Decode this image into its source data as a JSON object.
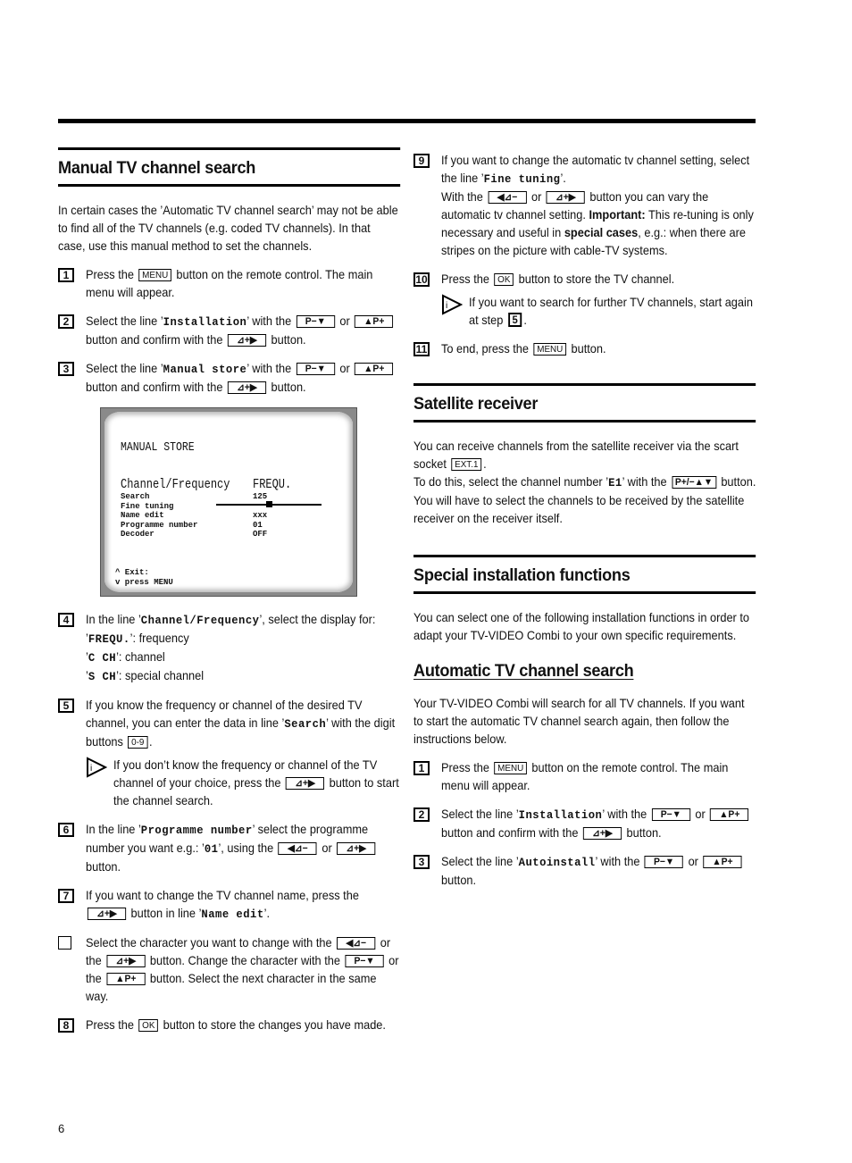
{
  "page_number": "6",
  "left": {
    "heading": "Manual TV channel search",
    "intro": "In certain cases the ’Automatic TV channel search’ may not be able to find all of the TV channels (e.g. coded TV channels). In that case, use this manual method to set the channels.",
    "steps": [
      {
        "num": "1",
        "parts": [
          "Press the ",
          {
            "key": "MENU"
          },
          " button on the remote control. The main menu will appear."
        ]
      },
      {
        "num": "2",
        "parts": [
          "Select the line ’",
          {
            "mono": "Installation"
          },
          "’ with the ",
          {
            "key": "P−▼"
          },
          " or ",
          {
            "key": "▲P+"
          },
          " button and confirm with the ",
          {
            "key": "⊿+▶"
          },
          " button."
        ]
      },
      {
        "num": "3",
        "parts": [
          "Select the line ’",
          {
            "mono": "Manual store"
          },
          "’ with the ",
          {
            "key": "P−▼"
          },
          " or ",
          {
            "key": "▲P+"
          },
          " button and confirm with the ",
          {
            "key": "⊿+▶"
          },
          " button."
        ]
      }
    ],
    "tv_screen": {
      "title": "MANUAL STORE",
      "channel_frequency_label": "Channel/Frequency",
      "channel_frequency_value": "FREQU.",
      "rows": [
        {
          "label": "Search",
          "value": "125"
        },
        {
          "label": "Fine tuning",
          "value": ""
        },
        {
          "label": "Name edit",
          "value": "xxx"
        },
        {
          "label": "Programme number",
          "value": "01"
        },
        {
          "label": "Decoder",
          "value": "OFF"
        }
      ],
      "fine_tuning_level": 0.5,
      "exit_line1": "^ Exit:",
      "exit_line2": "v press MENU"
    },
    "steps2": [
      {
        "num": "4",
        "parts": [
          "In the line ’",
          {
            "mono": "Channel/Frequency"
          },
          "’, select the display for:",
          {
            "br": true
          },
          "’",
          {
            "mono": "FREQU."
          },
          "’: frequency",
          {
            "br": true
          },
          "’",
          {
            "mono": "C CH"
          },
          "’: channel",
          {
            "br": true
          },
          "’",
          {
            "mono": "S CH"
          },
          "’: special channel"
        ]
      },
      {
        "num": "5",
        "parts": [
          "If you know the frequency or channel of the desired TV channel, you can enter the data in line ’",
          {
            "mono": "Search"
          },
          "’ with the digit buttons ",
          {
            "key": "0-9"
          },
          "."
        ],
        "tip": [
          "If you don’t know the frequency or channel of the TV channel of your choice, press the ",
          {
            "key": "⊿+▶"
          },
          " button to start the channel search."
        ]
      },
      {
        "num": "6",
        "parts": [
          "In the line ’",
          {
            "mono": "Programme number"
          },
          "’ select the programme number you want e.g.: ’",
          {
            "mono": "01"
          },
          "’, using the ",
          {
            "key": "◀⊿−"
          },
          " or ",
          {
            "key": "⊿+▶"
          },
          " button."
        ]
      },
      {
        "num": "7",
        "parts": [
          "If you want to change the TV channel name, press the ",
          {
            "key": "⊿+▶"
          },
          " button in line ’",
          {
            "mono": "Name edit"
          },
          "’."
        ]
      },
      {
        "num": "",
        "square": true,
        "parts": [
          "Select the character you want to change with the ",
          {
            "key": "◀⊿−"
          },
          " or the ",
          {
            "key": "⊿+▶"
          },
          " button. Change the character with the ",
          {
            "key": "P−▼"
          },
          " or the ",
          {
            "key": "▲P+"
          },
          " button. Select the next character in the same way."
        ]
      },
      {
        "num": "8",
        "parts": [
          "Press the ",
          {
            "key": "OK"
          },
          " button to store the changes you have made."
        ]
      }
    ]
  },
  "right": {
    "steps": [
      {
        "num": "9",
        "parts": [
          "If you want to change the automatic tv channel setting, select the line ’",
          {
            "mono": "Fine tuning"
          },
          "’.",
          {
            "br": true
          },
          "With the ",
          {
            "key": "◀⊿−"
          },
          " or ",
          {
            "key": "⊿+▶"
          },
          " button you can vary the automatic tv channel setting. ",
          {
            "bold": "Important:"
          },
          " This re-tuning is only necessary and useful in ",
          {
            "bold": "special cases"
          },
          ", e.g.: when there are stripes on the picture with cable-TV systems."
        ]
      },
      {
        "num": "10",
        "parts": [
          "Press the ",
          {
            "key": "OK"
          },
          " button to store the TV channel."
        ],
        "tip": [
          "If you want to search for further TV channels, start again at step ",
          {
            "numbox": "5"
          },
          "."
        ]
      },
      {
        "num": "11",
        "parts": [
          "To end, press the ",
          {
            "key": "MENU"
          },
          " button."
        ]
      }
    ],
    "satellite": {
      "heading": "Satellite receiver",
      "parts": [
        "You can receive channels from the satellite receiver via the scart socket ",
        {
          "key": "EXT.1"
        },
        ".",
        {
          "br": true
        },
        "To do this, select the channel number ’",
        {
          "mono": "E1"
        },
        "’ with the ",
        {
          "key": "P+/−▲▼"
        },
        " button. You will have to select the channels to be received by the satellite receiver on the receiver itself."
      ]
    },
    "special": {
      "heading": "Special installation functions",
      "intro": "You can select one of the following installation functions in order to adapt your TV-VIDEO Combi to your own specific requirements."
    },
    "auto": {
      "heading": "Automatic TV channel search",
      "intro": "Your TV-VIDEO Combi will search for all TV channels. If you want to start the automatic TV channel search again, then follow the instructions below.",
      "steps": [
        {
          "num": "1",
          "parts": [
            "Press the ",
            {
              "key": "MENU"
            },
            " button on the remote control. The main menu will appear."
          ]
        },
        {
          "num": "2",
          "parts": [
            "Select the line ’",
            {
              "mono": "Installation"
            },
            "’ with the ",
            {
              "key": "P−▼"
            },
            " or ",
            {
              "key": "▲P+"
            },
            " button and confirm with the ",
            {
              "key": "⊿+▶"
            },
            " button."
          ]
        },
        {
          "num": "3",
          "parts": [
            "Select the line ’",
            {
              "mono": "Autoinstall"
            },
            "’ with the ",
            {
              "key": "P−▼"
            },
            " or ",
            {
              "key": "▲P+"
            },
            " button."
          ]
        }
      ]
    }
  }
}
